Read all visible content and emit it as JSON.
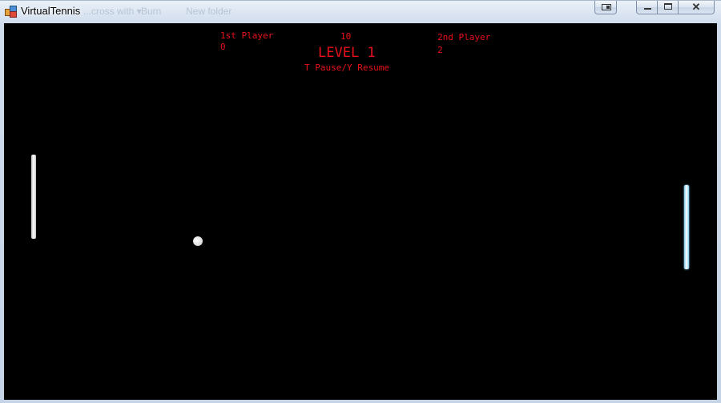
{
  "window": {
    "title": "VirtualTennis",
    "background_ghost_items": [
      "...cross with ▾",
      "Burn",
      "New folder"
    ]
  },
  "hud": {
    "player1_label": "1st Player",
    "player1_score": "0",
    "timer": "10",
    "player2_label": "2nd Player",
    "player2_score": "2",
    "level": "LEVEL 1",
    "hint": "T Pause/Y Resume"
  },
  "colors": {
    "court": "#000000",
    "hud_text": "#e8101a",
    "left_paddle": "#ffffff",
    "right_paddle": "#8ad4ff",
    "ball": "#ffffff"
  }
}
